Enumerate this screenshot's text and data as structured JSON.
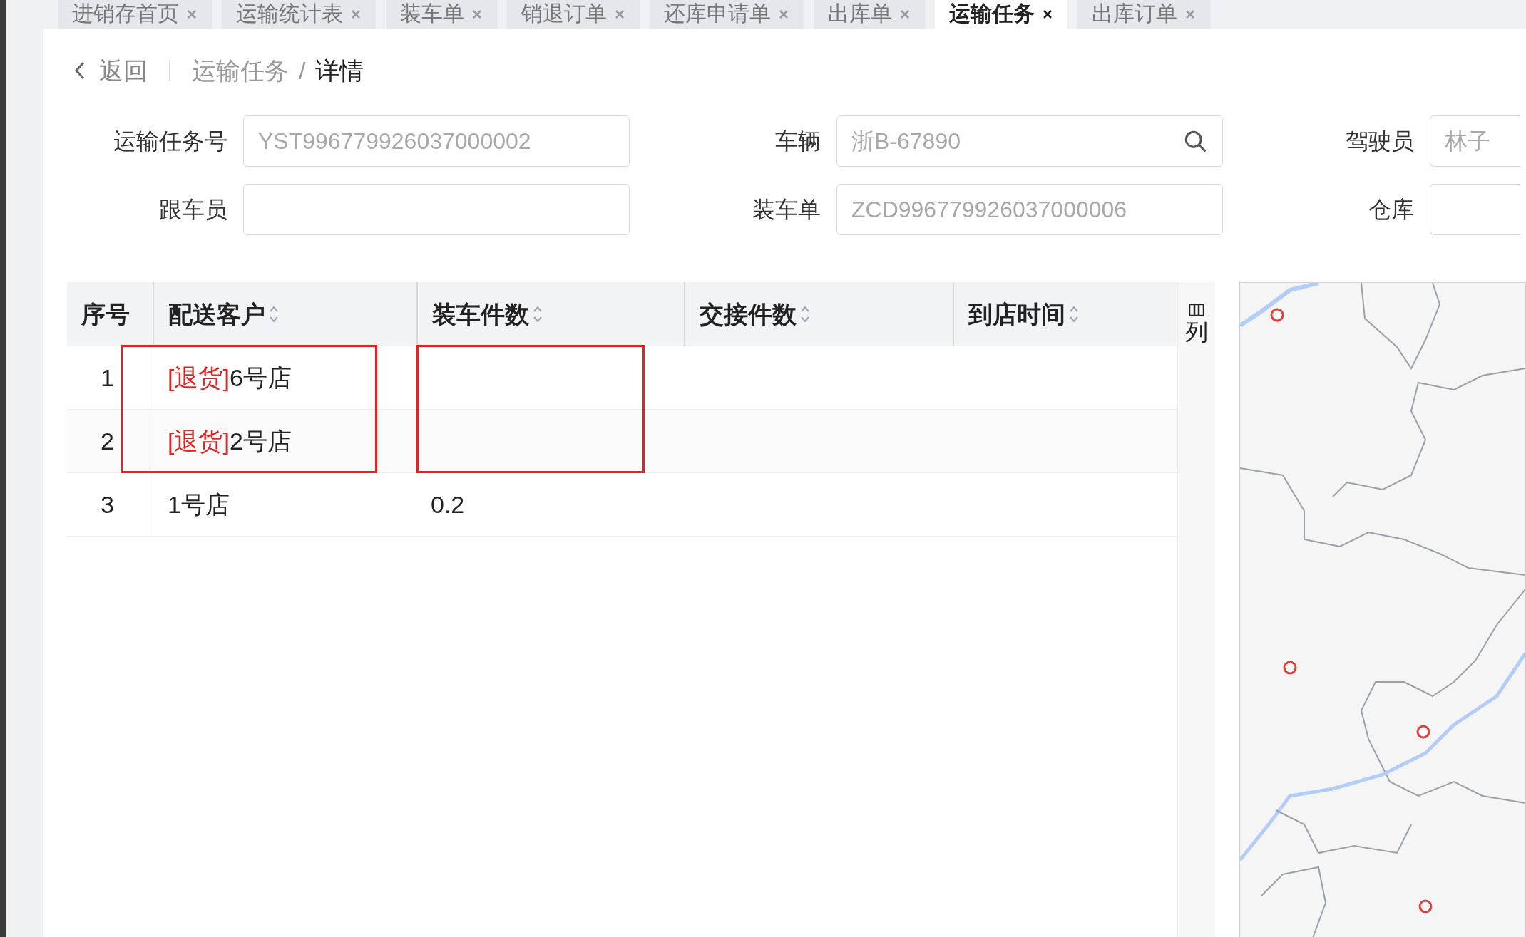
{
  "tabs": [
    {
      "label": "进销存首页",
      "selected": false
    },
    {
      "label": "运输统计表",
      "selected": false
    },
    {
      "label": "装车单",
      "selected": false
    },
    {
      "label": "销退订单",
      "selected": false
    },
    {
      "label": "还库申请单",
      "selected": false
    },
    {
      "label": "出库单",
      "selected": false
    },
    {
      "label": "运输任务",
      "selected": true
    },
    {
      "label": "出库订单",
      "selected": false
    }
  ],
  "breadcrumb": {
    "back": "返回",
    "parent": "运输任务",
    "separator": "/",
    "current": "详情"
  },
  "form": [
    {
      "label": "运输任务号",
      "value": "YST996779926037000002",
      "kind": "text"
    },
    {
      "label": "车辆",
      "value": "浙B-67890",
      "kind": "search"
    },
    {
      "label": "驾驶员",
      "value": "林子",
      "kind": "text"
    },
    {
      "label": "跟车员",
      "kind": "text"
    },
    {
      "label": "装车单",
      "value": "ZCD996779926037000006",
      "kind": "text"
    },
    {
      "label": "仓库",
      "kind": "text"
    }
  ],
  "table": {
    "columns": [
      {
        "label": "序号",
        "sortable": false
      },
      {
        "label": "配送客户",
        "sortable": true
      },
      {
        "label": "装车件数",
        "sortable": true
      },
      {
        "label": "交接件数",
        "sortable": true
      },
      {
        "label": "到店时间",
        "sortable": true
      }
    ],
    "column_button": "列",
    "rows": [
      {
        "index": "1",
        "customer": [
          {
            "kind": "tag",
            "text": "[退货]"
          },
          {
            "kind": "name",
            "text": "6号店"
          }
        ],
        "mark_customer": true,
        "mark_loaded": true
      },
      {
        "index": "2",
        "customer": [
          {
            "kind": "tag",
            "text": "[退货]"
          },
          {
            "kind": "name",
            "text": "2号店"
          }
        ],
        "mark_customer": true,
        "mark_loaded": true
      },
      {
        "index": "3",
        "customer": [
          {
            "kind": "name",
            "text": "1号店"
          }
        ],
        "loaded": "0.2",
        "mark_customer": false,
        "mark_loaded": false
      }
    ]
  }
}
